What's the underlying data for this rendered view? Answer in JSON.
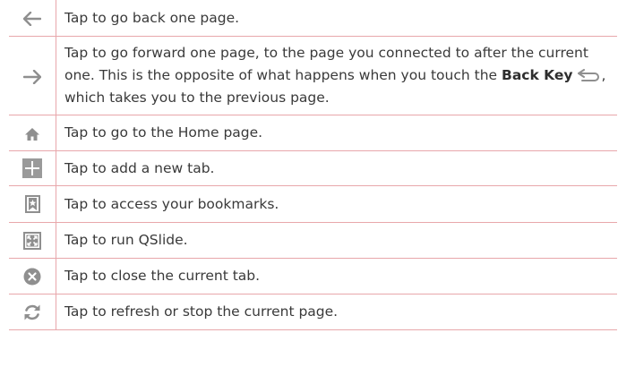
{
  "rows": [
    {
      "icon": "back-arrow-icon",
      "text": "Tap to go back one page."
    },
    {
      "icon": "forward-arrow-icon",
      "text_before": "Tap to go forward one page, to the page you connected to after the current one. This is the opposite of what happens when you touch the ",
      "bold": "Back Key",
      "icon_inline": "back-key-icon",
      "text_after": ", which takes you to the previous page."
    },
    {
      "icon": "home-icon",
      "text": "Tap to go to the Home page."
    },
    {
      "icon": "plus-icon",
      "text": "Tap to add a new tab."
    },
    {
      "icon": "bookmark-icon",
      "text": "Tap to access your bookmarks."
    },
    {
      "icon": "qslide-icon",
      "text": "Tap to run QSlide."
    },
    {
      "icon": "close-icon",
      "text": "Tap to close the current tab."
    },
    {
      "icon": "refresh-icon",
      "text": "Tap to refresh or stop the current page."
    }
  ],
  "colors": {
    "border": "#e8a7ab",
    "icon_gray": "#8f8f8f",
    "text": "#3a3a3a"
  }
}
